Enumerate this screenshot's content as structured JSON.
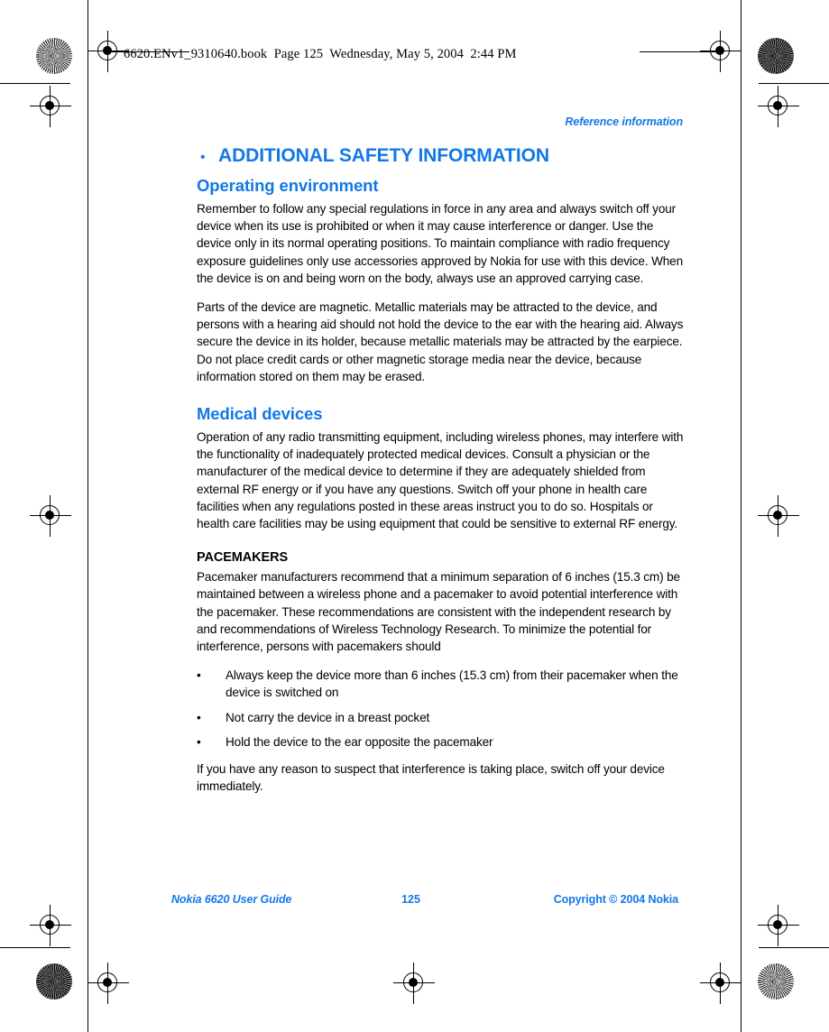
{
  "book_header": "6620.ENv1_9310640.book  Page 125  Wednesday, May 5, 2004  2:44 PM",
  "running_head": "Reference information",
  "colors": {
    "heading_blue": "#1278e8",
    "body_black": "#000000",
    "page_background": "#ffffff"
  },
  "content": {
    "chapter": {
      "bullet": "•",
      "title": "ADDITIONAL SAFETY INFORMATION"
    },
    "sections": [
      {
        "heading": "Operating environment",
        "paragraphs": [
          "Remember to follow any special regulations in force in any area and always switch off your device when its use is prohibited or when it may cause interference or danger. Use the device only in its normal operating positions. To maintain compliance with radio frequency exposure guidelines only use accessories approved by Nokia for use with this device. When the device is on and being worn on the body, always use an approved carrying case.",
          "Parts of the device are magnetic. Metallic materials may be attracted to the device, and persons with a hearing aid should not hold the device to the ear with the hearing aid. Always secure the device in its holder, because metallic materials may be attracted by the earpiece. Do not place credit cards or other magnetic storage media near the device, because information stored on them may be erased."
        ]
      },
      {
        "heading": "Medical devices",
        "paragraphs": [
          "Operation of any radio transmitting equipment, including wireless phones, may interfere with the functionality of inadequately protected medical devices. Consult a physician or the manufacturer of the medical device to determine if they are adequately shielded from external RF energy or if you have any questions. Switch off your phone in health care facilities when any regulations posted in these areas instruct you to do so. Hospitals or health care facilities may be using equipment that could be sensitive to external RF energy."
        ]
      }
    ],
    "subsection": {
      "heading": "PACEMAKERS",
      "intro": "Pacemaker manufacturers recommend that a minimum separation of 6 inches (15.3 cm) be maintained between a wireless phone and a pacemaker to avoid potential interference with the pacemaker. These recommendations are consistent with the independent research by and recommendations of Wireless Technology Research. To minimize the potential for interference, persons with pacemakers should",
      "bullet_char": "•",
      "bullets": [
        "Always keep the device more than 6 inches (15.3 cm) from their pacemaker when the device is switched on",
        "Not carry the device in a breast pocket",
        "Hold the device to the ear opposite the pacemaker"
      ],
      "closing": "If you have any reason to suspect that interference is taking place, switch off your device immediately."
    }
  },
  "footer": {
    "left": "Nokia 6620 User Guide",
    "page_number": "125",
    "right": "Copyright © 2004 Nokia"
  }
}
